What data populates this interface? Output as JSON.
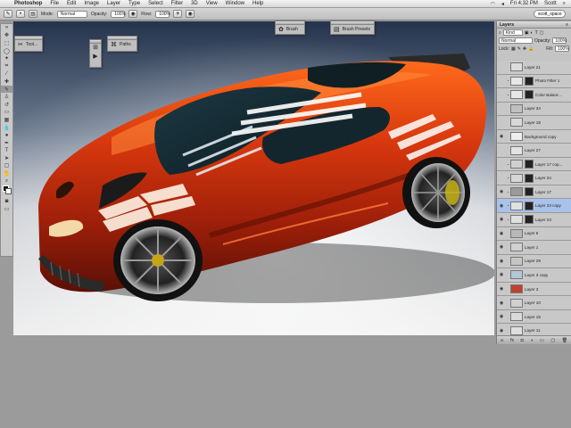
{
  "menubar": {
    "app": "Photoshop",
    "items": [
      "File",
      "Edit",
      "Image",
      "Layer",
      "Type",
      "Select",
      "Filter",
      "3D",
      "View",
      "Window",
      "Help"
    ],
    "clock": "Fri 4:32 PM",
    "user": "Scott"
  },
  "options": {
    "mode_label": "Mode:",
    "mode_value": "Normal",
    "opacity_label": "Opacity:",
    "opacity_value": "100%",
    "flow_label": "Flow:",
    "flow_value": "100%",
    "workspace": "scott_space"
  },
  "mini_panels": {
    "tools": "Tool...",
    "paths": "Paths",
    "brush": "Brush",
    "brush_presets": "Brush Presets"
  },
  "layers_panel": {
    "tab": "Layers",
    "kind": "Kind",
    "blend": "Normal",
    "opacity_label": "Opacity:",
    "opacity_value": "100%",
    "lock_label": "Lock:",
    "fill_label": "Fill:",
    "fill_value": "100%",
    "layers": [
      {
        "name": "Layer 21",
        "visible": false,
        "thumb": "#dcdcdc",
        "mask": false,
        "selected": false
      },
      {
        "name": "Photo Filter 1",
        "visible": false,
        "thumb": "#e8e8e8",
        "mask": true,
        "selected": false
      },
      {
        "name": "Color Balanc...",
        "visible": false,
        "thumb": "#e8e8e8",
        "mask": true,
        "selected": false
      },
      {
        "name": "Layer 34",
        "visible": false,
        "thumb": "#c0c0c0",
        "mask": false,
        "selected": false
      },
      {
        "name": "Layer 18",
        "visible": false,
        "thumb": "#d8d8d8",
        "mask": false,
        "selected": false
      },
      {
        "name": "Background copy",
        "visible": true,
        "thumb": "#eeeeee",
        "mask": false,
        "selected": false
      },
      {
        "name": "Layer 27",
        "visible": false,
        "thumb": "#e2e2e2",
        "mask": false,
        "selected": false
      },
      {
        "name": "Layer 17 cop...",
        "visible": false,
        "thumb": "#cfcfcf",
        "mask": true,
        "selected": false
      },
      {
        "name": "Layer 24",
        "visible": false,
        "thumb": "#d6d6d6",
        "mask": true,
        "selected": false
      },
      {
        "name": "Layer 17",
        "visible": true,
        "thumb": "#9a9a9a",
        "mask": true,
        "selected": false
      },
      {
        "name": "Layer 23 copy",
        "visible": true,
        "thumb": "#e0e0e0",
        "mask": true,
        "selected": true
      },
      {
        "name": "Layer 23",
        "visible": true,
        "thumb": "#e0e0e0",
        "mask": true,
        "selected": false
      },
      {
        "name": "Layer 6",
        "visible": true,
        "thumb": "#b8b8b8",
        "mask": false,
        "selected": false
      },
      {
        "name": "Layer 1",
        "visible": true,
        "thumb": "#d0d0d0",
        "mask": false,
        "selected": false
      },
      {
        "name": "Layer 29",
        "visible": true,
        "thumb": "#c6c6c6",
        "mask": false,
        "selected": false
      },
      {
        "name": "Layer 3 copy",
        "visible": true,
        "thumb": "#b0c8d4",
        "mask": false,
        "selected": false
      },
      {
        "name": "Layer 3",
        "visible": true,
        "thumb": "#bf4030",
        "mask": false,
        "selected": false
      },
      {
        "name": "Layer 10",
        "visible": true,
        "thumb": "#d0d0d0",
        "mask": false,
        "selected": false
      },
      {
        "name": "Layer 15",
        "visible": true,
        "thumb": "#dadada",
        "mask": false,
        "selected": false
      },
      {
        "name": "Layer 11",
        "visible": true,
        "thumb": "#dedede",
        "mask": false,
        "selected": false
      }
    ]
  },
  "colors": {
    "car_body": "#c2300f",
    "sky_top": "#24344d",
    "selection": "#a9c2ea"
  },
  "icons": [
    "apple-icon",
    "brush-icon",
    "airbrush-icon",
    "search-icon",
    "wifi-icon",
    "eye-icon"
  ]
}
